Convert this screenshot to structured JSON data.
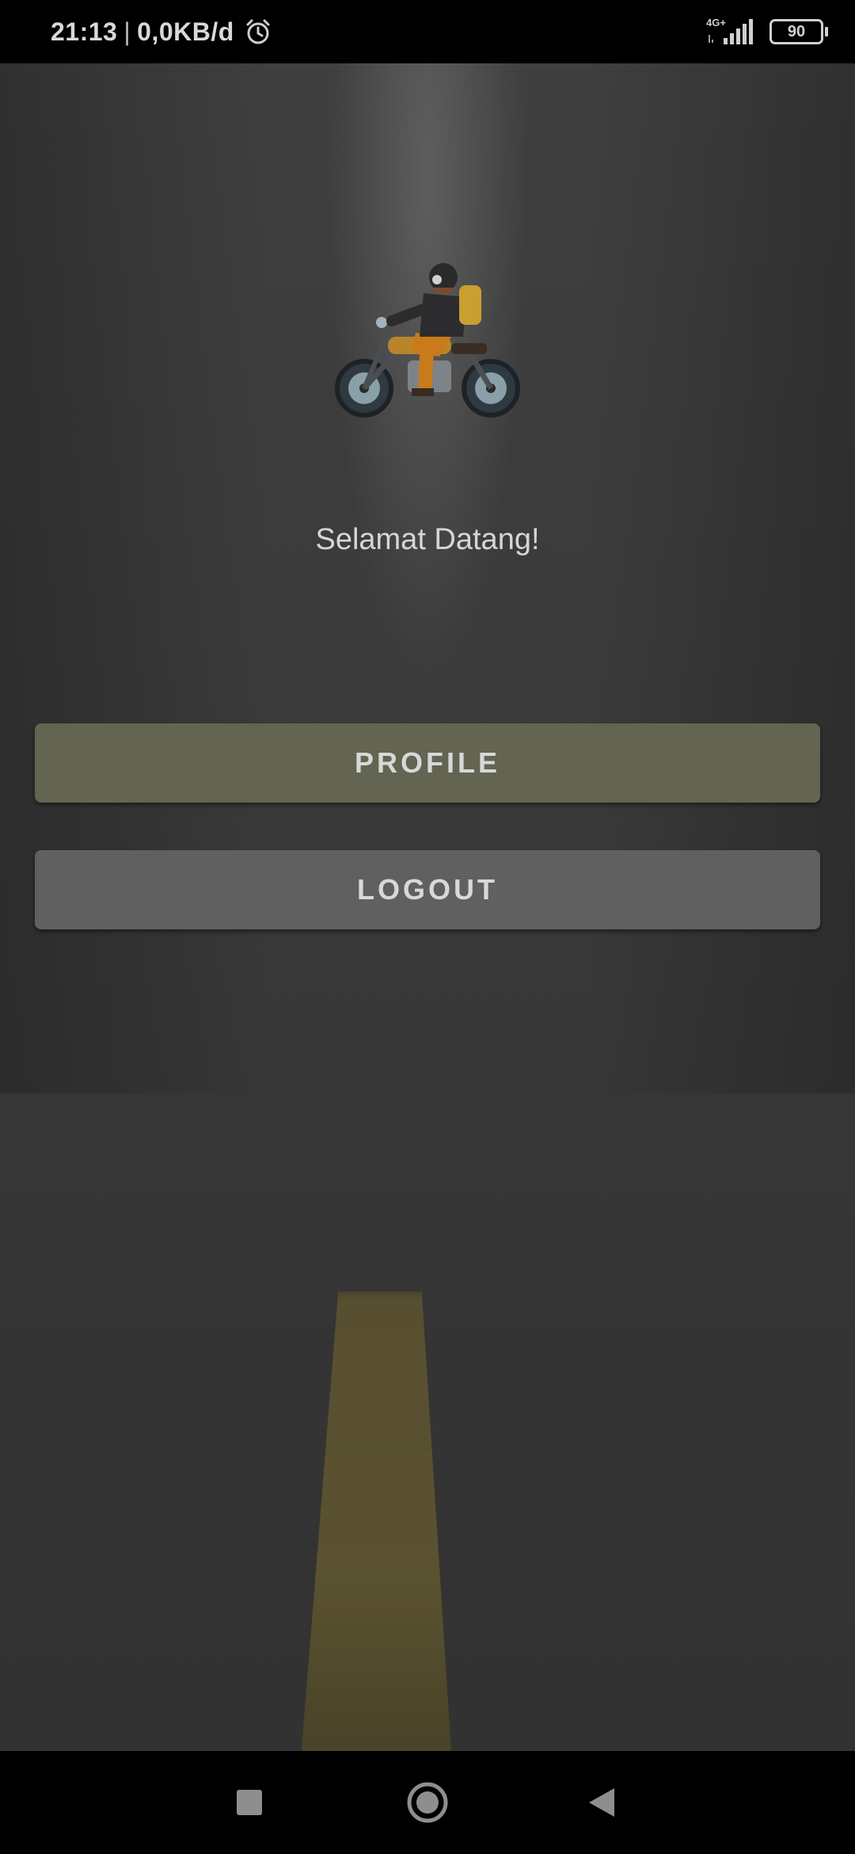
{
  "status_bar": {
    "time": "21:13",
    "separator": "|",
    "data_speed": "0,0KB/d",
    "network_label": "4G+",
    "battery_level": "90",
    "icons": [
      "alarm-icon",
      "signal-icon",
      "battery-icon"
    ]
  },
  "main": {
    "logo_icon": "motorcycle-rider-icon",
    "welcome_text": "Selamat Datang!",
    "profile_button": "PROFILE",
    "logout_button": "LOGOUT"
  },
  "nav_bar": {
    "icons": [
      "recent-apps-icon",
      "home-icon",
      "back-icon"
    ]
  },
  "colors": {
    "profile_button_bg": "#636451",
    "logout_button_bg": "#606060",
    "text": "#d8d8d8"
  }
}
